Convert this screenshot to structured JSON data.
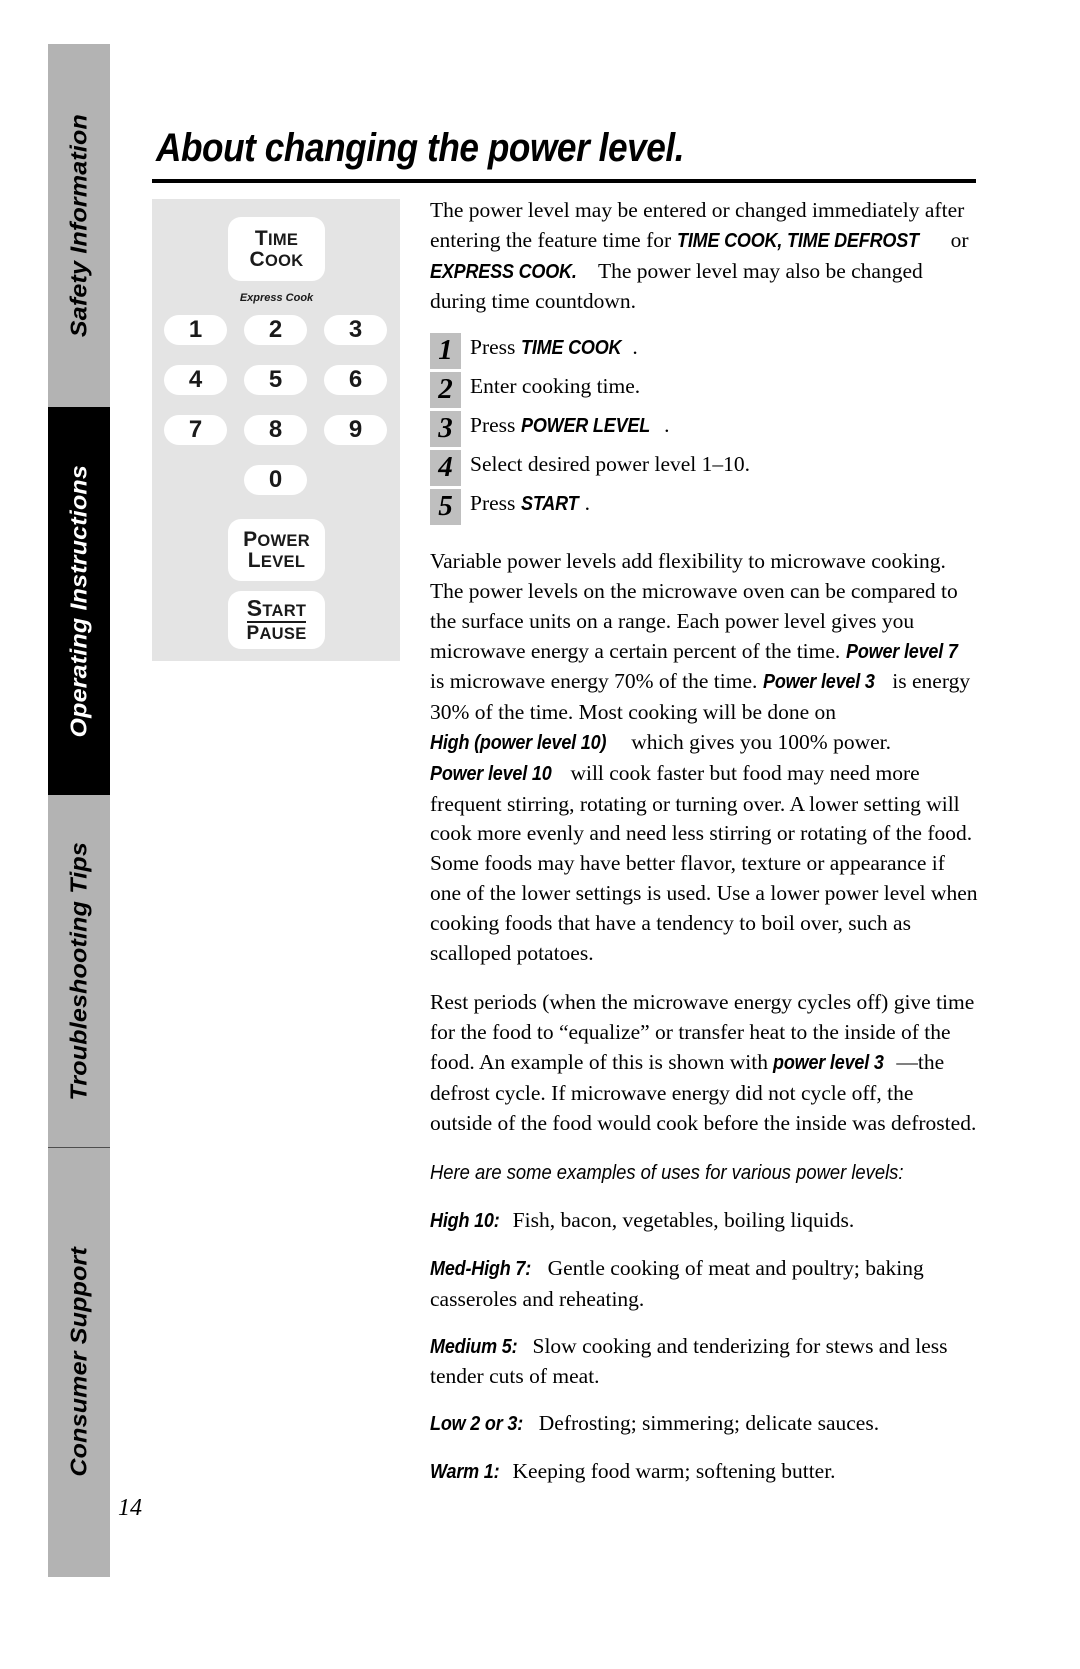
{
  "page": {
    "title": "About changing the power level.",
    "page_number": "14"
  },
  "sidebar": {
    "tabs": [
      {
        "label": "Safety Information",
        "style": "gray",
        "active": false
      },
      {
        "label": "Operating Instructions",
        "style": "black",
        "active": true
      },
      {
        "label": "Troubleshooting Tips",
        "style": "gray",
        "active": false
      },
      {
        "label": "Consumer Support",
        "style": "gray",
        "active": false
      }
    ]
  },
  "keypad": {
    "time_cook": {
      "line1": "T",
      "line1_rest": "IME",
      "line2": "C",
      "line2_rest": "OOK"
    },
    "express_cook_label": "Express Cook",
    "numbers": [
      "1",
      "2",
      "3",
      "4",
      "5",
      "6",
      "7",
      "8",
      "9"
    ],
    "zero": "0",
    "power_level": {
      "line1": "P",
      "line1_rest": "OWER",
      "line2": "L",
      "line2_rest": "EVEL"
    },
    "start_pause": {
      "start": "S",
      "start_rest": "TART",
      "pause": "P",
      "pause_rest": "AUSE"
    }
  },
  "intro": {
    "part1": "The power level may be entered or changed immediately after entering the feature time for ",
    "em1": "TIME COOK, TIME DEFROST",
    "part2": " or ",
    "em2": "EXPRESS COOK.",
    "part3": " The power level may also be changed during time countdown."
  },
  "steps": [
    {
      "num": "1",
      "text_before": "Press ",
      "em": "TIME COOK",
      "text_after": "."
    },
    {
      "num": "2",
      "text_before": "Enter cooking time.",
      "em": "",
      "text_after": ""
    },
    {
      "num": "3",
      "text_before": "Press ",
      "em": "POWER LEVEL",
      "text_after": "."
    },
    {
      "num": "4",
      "text_before": "Select desired power level 1–10.",
      "em": "",
      "text_after": ""
    },
    {
      "num": "5",
      "text_before": "Press ",
      "em": "START",
      "text_after": "."
    }
  ],
  "body": {
    "para1": {
      "s1": "Variable power levels add flexibility to microwave cooking. The power levels on the microwave oven can be compared to the surface units on a range. Each power level gives you microwave energy a certain percent of the time. ",
      "e1": "Power level 7",
      "s2": " is microwave energy 70% of the time. ",
      "e2": "Power level 3",
      "s3": " is energy 30% of the time. Most cooking will be done on ",
      "e3": "High (power level 10)",
      "s4": " which gives you 100% power. ",
      "e4": "Power level 10",
      "s5": " will cook faster but food may need more frequent stirring, rotating or turning over. A lower setting will cook more evenly and need less stirring or rotating of the food. Some foods may have better flavor, texture or appearance if one of the lower settings is used. Use a lower power level when cooking foods that have a tendency to boil over, such as scalloped potatoes."
    },
    "para2": {
      "s1": "Rest periods (when the microwave energy cycles off) give time for the food to “equalize” or transfer heat to the inside of the food. An example of this is shown with ",
      "e1": "power level 3",
      "s2": "—the defrost cycle. If microwave energy did not cycle off, the outside of the food would cook before the inside was defrosted."
    },
    "examples_heading": "Here are some examples of uses for various power levels:",
    "examples": [
      {
        "label": "High 10:",
        "text": " Fish, bacon, vegetables, boiling liquids."
      },
      {
        "label": "Med-High 7:",
        "text": " Gentle cooking of meat and poultry; baking casseroles and reheating."
      },
      {
        "label": "Medium 5:",
        "text": " Slow cooking and tenderizing for stews and less tender cuts of meat."
      },
      {
        "label": "Low 2 or 3:",
        "text": " Defrosting; simmering; delicate sauces."
      },
      {
        "label": "Warm 1:",
        "text": " Keeping food warm; softening butter."
      }
    ]
  },
  "colors": {
    "tab_gray": "#b3b3b3",
    "tab_black": "#000000",
    "keypad_panel": "#e4e4e4",
    "key_white": "#ffffff",
    "step_box_gray": "#bfbfbf"
  }
}
